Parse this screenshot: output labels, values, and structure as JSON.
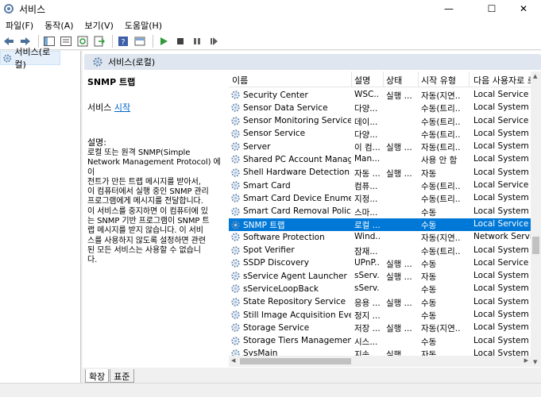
{
  "window": {
    "title": "서비스",
    "minimize_glyph": "—",
    "maximize_glyph": "☐",
    "close_glyph": "✕"
  },
  "menu": [
    "파일(F)",
    "동작(A)",
    "보기(V)",
    "도움말(H)"
  ],
  "toolbar": {
    "icons": [
      "back-icon",
      "forward-icon",
      "show-tree-icon",
      "properties-icon",
      "refresh-icon",
      "export-icon",
      "help-icon",
      "console-icon",
      "start-icon",
      "stop-icon",
      "pause-icon",
      "restart-icon"
    ]
  },
  "tree": {
    "root_label": "서비스(로컬)"
  },
  "content": {
    "header_title": "서비스(로컬)"
  },
  "description": {
    "service_name": "SNMP 트랩",
    "start_prefix": "서비스 ",
    "start_link": "시작",
    "label": "설명:",
    "lines": [
      "로컬 또는 원격 SNMP(Simple",
      "Network Management Protocol) 에이",
      "전트가 만든 트랩 메시지를 받아서,",
      "이 컴퓨터에서 실행 중인 SNMP 관리",
      "프로그램에게 메시지를 전달합니다.",
      "이 서비스를 중지하면 이 컴퓨터에 있",
      "는 SNMP 기반 프로그램이 SNMP 트",
      "랩 메시지를 받지 않습니다. 이 서비",
      "스를 사용하지 않도록 설정하면 관련",
      "된 모든 서비스는 사용할 수 없습니",
      "다."
    ]
  },
  "list": {
    "columns": [
      "이름",
      "설명",
      "상태",
      "시작 유형",
      "다음 사용자로 로"
    ],
    "rows": [
      {
        "name": "Security Center",
        "desc": "WSC...",
        "status": "실행 ...",
        "type": "자동(지연...",
        "logon": "Local Service"
      },
      {
        "name": "Sensor Data Service",
        "desc": "다양...",
        "status": "",
        "type": "수동(트리...",
        "logon": "Local System"
      },
      {
        "name": "Sensor Monitoring Service",
        "desc": "데이...",
        "status": "",
        "type": "수동(트리...",
        "logon": "Local Service"
      },
      {
        "name": "Sensor Service",
        "desc": "다양...",
        "status": "",
        "type": "수동(트리...",
        "logon": "Local System"
      },
      {
        "name": "Server",
        "desc": "이 컴...",
        "status": "실행 ...",
        "type": "자동(트리...",
        "logon": "Local System"
      },
      {
        "name": "Shared PC Account Manager",
        "desc": "Man...",
        "status": "",
        "type": "사용 안 함",
        "logon": "Local System"
      },
      {
        "name": "Shell Hardware Detection",
        "desc": "자동 ...",
        "status": "실행 ...",
        "type": "자동",
        "logon": "Local System"
      },
      {
        "name": "Smart Card",
        "desc": "컴퓨...",
        "status": "",
        "type": "수동(트리...",
        "logon": "Local Service"
      },
      {
        "name": "Smart Card Device Enumera...",
        "desc": "지정...",
        "status": "",
        "type": "수동(트리...",
        "logon": "Local System"
      },
      {
        "name": "Smart Card Removal Policy",
        "desc": "스마...",
        "status": "",
        "type": "수동",
        "logon": "Local System"
      },
      {
        "name": "SNMP 트랩",
        "desc": "로컬 ...",
        "status": "",
        "type": "수동",
        "logon": "Local Service",
        "selected": true
      },
      {
        "name": "Software Protection",
        "desc": "Wind...",
        "status": "",
        "type": "자동(지연...",
        "logon": "Network Service"
      },
      {
        "name": "Spot Verifier",
        "desc": "잠재...",
        "status": "",
        "type": "수동(트리...",
        "logon": "Local System"
      },
      {
        "name": "SSDP Discovery",
        "desc": "UPnP...",
        "status": "실행 ...",
        "type": "수동",
        "logon": "Local Service"
      },
      {
        "name": "sService Agent Launcher",
        "desc": "sServ...",
        "status": "실행 ...",
        "type": "자동",
        "logon": "Local System"
      },
      {
        "name": "sServiceLoopBack",
        "desc": "sServ...",
        "status": "",
        "type": "수동",
        "logon": "Local System"
      },
      {
        "name": "State Repository Service",
        "desc": "응용 ...",
        "status": "실행 ...",
        "type": "수동",
        "logon": "Local System"
      },
      {
        "name": "Still Image Acquisition Events",
        "desc": "정지 ...",
        "status": "",
        "type": "수동",
        "logon": "Local System"
      },
      {
        "name": "Storage Service",
        "desc": "저장 ...",
        "status": "실행 ...",
        "type": "자동(지연...",
        "logon": "Local System"
      },
      {
        "name": "Storage Tiers Management",
        "desc": "시스...",
        "status": "",
        "type": "수동",
        "logon": "Local System"
      },
      {
        "name": "SysMain",
        "desc": "지속...",
        "status": "실행 ...",
        "type": "자동",
        "logon": "Local System"
      }
    ]
  },
  "tabs": [
    "확장",
    "표준"
  ],
  "colors": {
    "selection": "#0078d7",
    "link": "#0066cc",
    "header_bg": "#dfe6ef"
  }
}
